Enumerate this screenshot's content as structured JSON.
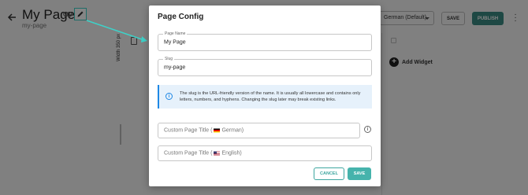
{
  "header": {
    "page_title": "My Page",
    "page_slug": "my-page",
    "language_select": "German (Default)",
    "save_label": "SAVE",
    "publish_label": "PUBLISH"
  },
  "canvas": {
    "width_label": "Width 350 px"
  },
  "right_panel": {
    "add_widget_label": "Add Widget"
  },
  "modal": {
    "title": "Page Config",
    "page_name": {
      "label": "Page Name",
      "value": "My Page"
    },
    "slug": {
      "label": "Slug",
      "value": "my-page"
    },
    "info_text": "The slug is the URL-friendly version of the name. It is usually all lowercase and contains only letters, numbers, and hyphens. Changing the slug later may break existing links.",
    "custom_title_de": {
      "prefix": "Custom Page Title (",
      "lang": "German)"
    },
    "custom_title_en": {
      "prefix": "Custom Page Title (",
      "lang": "English)"
    },
    "cancel_label": "CANCEL",
    "save_label": "SAVE"
  },
  "colors": {
    "accent": "#46b3ac",
    "publish": "#3b8a83",
    "highlight": "#3ed1c8",
    "info": "#1e88e5"
  }
}
